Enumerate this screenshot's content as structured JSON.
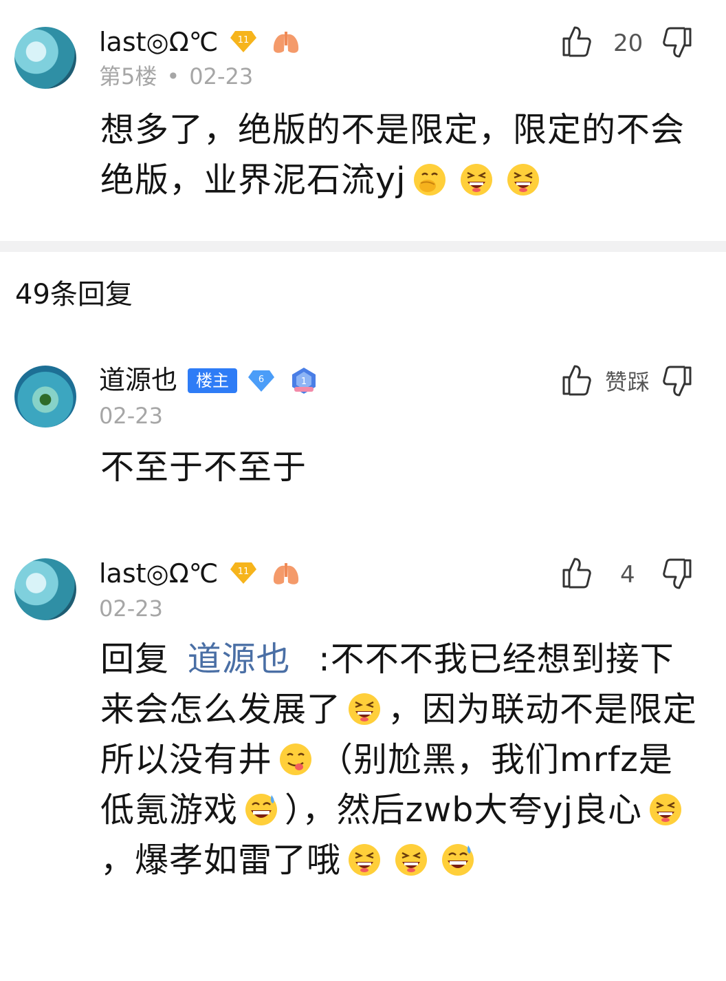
{
  "floor_post": {
    "username": "last◎Ω℃",
    "level": "11",
    "floor": "第5楼",
    "separator": "•",
    "date": "02-23",
    "like_count": "20",
    "content": "想多了，绝版的不是限定，限定的不会绝版，业界泥石流yj",
    "emojis": [
      "face-with-hand-over-mouth-emoji",
      "grinning-squinting-emoji",
      "grinning-squinting-emoji"
    ]
  },
  "replies_header": {
    "label": "49条回复"
  },
  "replies": [
    {
      "username": "道源也",
      "host_badge": "楼主",
      "level": "6",
      "rank": "1",
      "date": "02-23",
      "like_label": "赞",
      "dislike_label": "踩",
      "content": "不至于不至于"
    },
    {
      "username": "last◎Ω℃",
      "level": "11",
      "date": "02-23",
      "like_count": "4",
      "reply_prefix": "回复",
      "mention": "道源也",
      "segments": [
        ":不不不我已经想到接下来会怎么发展了",
        "，因为联动不是限定所以没有井",
        "（别尬黑，我们mrfz是低氪游戏",
        "），然后zwb大夸yj良心",
        "，爆孝如雷了哦"
      ]
    }
  ],
  "colors": {
    "accent_blue": "#2e7cf6",
    "mention_blue": "#4a6fa5",
    "meta_gray": "#a6a6a6",
    "divider": "#f1f1f2"
  }
}
